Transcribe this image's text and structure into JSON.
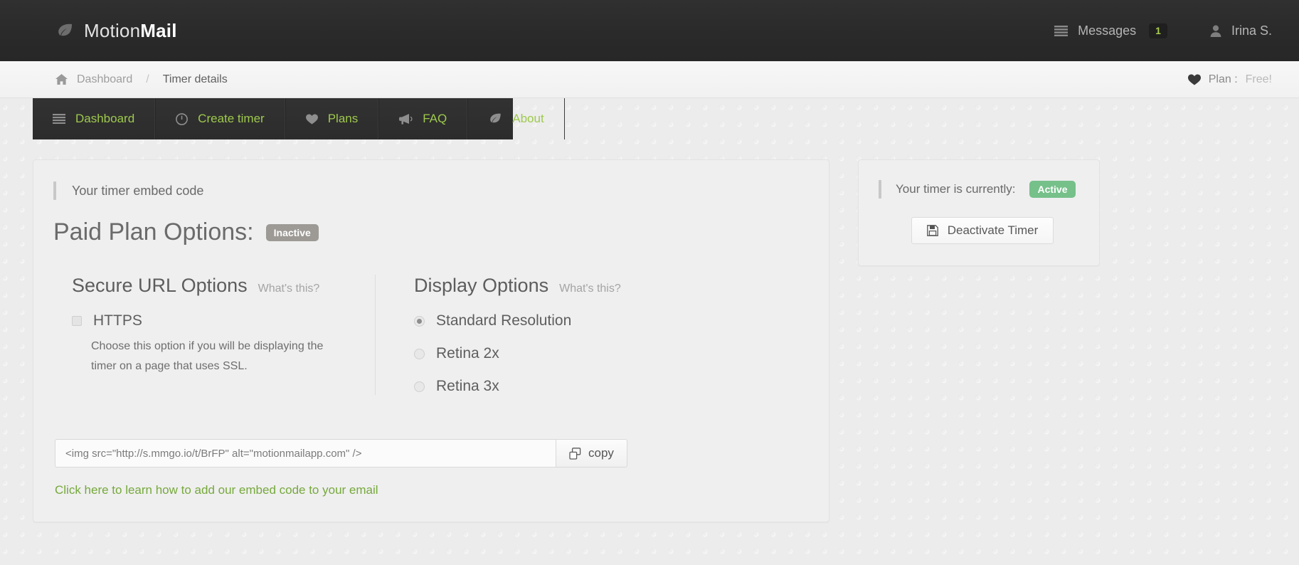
{
  "topbar": {
    "brand_light": "Motion",
    "brand_bold": "Mail",
    "brand_icon": "leaf-icon",
    "messages_label": "Messages",
    "messages_icon": "list-icon",
    "messages_count": "1",
    "user_name": "Irina S.",
    "user_icon": "person-icon"
  },
  "breadcrumb": {
    "home_icon": "home-icon",
    "home_label": "Dashboard",
    "separator": "/",
    "current": "Timer details",
    "plan_icon": "heart-icon",
    "plan_label": "Plan :",
    "plan_value": "Free!"
  },
  "nav": {
    "items": [
      {
        "label": "Dashboard",
        "icon": "list-icon"
      },
      {
        "label": "Create timer",
        "icon": "clock-icon"
      },
      {
        "label": "Plans",
        "icon": "heart-icon"
      },
      {
        "label": "FAQ",
        "icon": "megaphone-icon"
      },
      {
        "label": "About",
        "icon": "leaf-icon"
      }
    ]
  },
  "main": {
    "section_label": "Your timer embed code",
    "title": "Paid Plan Options:",
    "title_badge": "Inactive",
    "secure_url": {
      "title": "Secure URL Options",
      "whats_this": "What's this?",
      "checkbox_label": "HTTPS",
      "checkbox_checked": false,
      "helper_text": "Choose this option if you will be displaying the timer on a page that uses SSL."
    },
    "display": {
      "title": "Display Options",
      "whats_this": "What's this?",
      "options": [
        {
          "label": "Standard Resolution",
          "selected": true
        },
        {
          "label": "Retina 2x",
          "selected": false
        },
        {
          "label": "Retina 3x",
          "selected": false
        }
      ]
    },
    "embed": {
      "value": "<img src=\"http://s.mmgo.io/t/BrFP\" alt=\"motionmailapp.com\" />",
      "placeholder": "<img src=\"http://s.mmgo.io/t/BrFP\" alt=\"motionmailapp.com\" />",
      "copy_label": "copy",
      "copy_icon": "copy-icon"
    },
    "learn_link": "Click here to learn how to add our embed code to your email"
  },
  "sidebar": {
    "status_label": "Your timer is currently:",
    "status_value": "Active",
    "deactivate_label": "Deactivate Timer",
    "deactivate_icon": "save-icon"
  },
  "colors": {
    "nav_green": "#9ec94d",
    "link_green": "#76a83c",
    "badge_active": "#76c08a",
    "badge_inactive": "#9d9a96",
    "topbar_dark": "#2b2b2b"
  }
}
